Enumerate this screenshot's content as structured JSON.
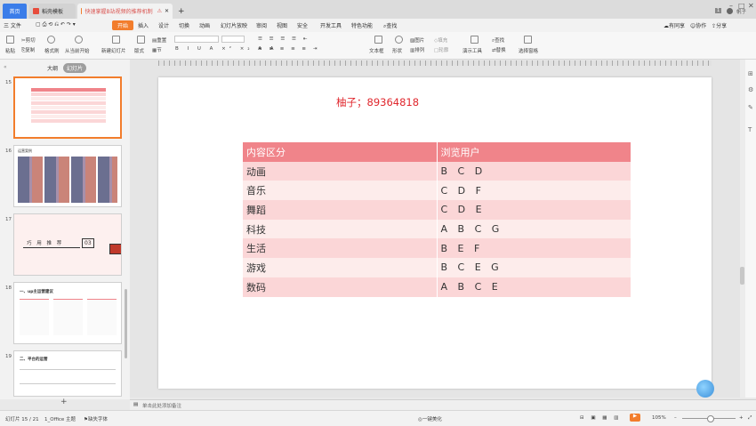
{
  "tabs": {
    "home": "首页",
    "template": "稻壳模板",
    "doc": "快速掌握B站视频的推荐机制",
    "add": "+"
  },
  "window": {
    "badge": "1",
    "user": "帆子"
  },
  "menubar": {
    "file": "三 文件",
    "items": [
      "开始",
      "插入",
      "设计",
      "切换",
      "动画",
      "幻灯片放映",
      "审阅",
      "视图",
      "安全",
      "开发工具",
      "特色功能"
    ],
    "active": "开始",
    "search": "查找",
    "right": [
      "有同享",
      "协作",
      "分享"
    ]
  },
  "ribbon": {
    "paste": "粘贴",
    "cut": "剪切",
    "copy": "复制",
    "format_painter": "格式刷",
    "from_start": "从当前开始",
    "new_slide": "新建幻灯片",
    "layout": "版式",
    "section": "节",
    "reset": "重置",
    "textbox": "文本框",
    "shape": "形状",
    "arrange": "排列",
    "picture": "图片",
    "fill": "填充",
    "outline": "轮廓",
    "presentation_tool": "演示工具",
    "find": "查找",
    "replace": "替换",
    "select_pane": "选择窗格"
  },
  "leftpane": {
    "tab_outline": "大纲",
    "tab_slides": "幻灯片",
    "slides": [
      {
        "num": "15",
        "selected": true
      },
      {
        "num": "16",
        "title": "运营案例"
      },
      {
        "num": "17",
        "title": "巧 用 推 荐",
        "badge": "03"
      },
      {
        "num": "18",
        "title": "一、up主运营建议"
      },
      {
        "num": "19",
        "title": "二、平台的运营"
      }
    ],
    "add_slide": "+"
  },
  "slide": {
    "title": "柚子；89364818",
    "table": {
      "headers": [
        "内容区分",
        "浏览用户"
      ],
      "rows": [
        [
          "动画",
          "B C D"
        ],
        [
          "音乐",
          "C D F"
        ],
        [
          "舞蹈",
          "C D E"
        ],
        [
          "科技",
          "A B C G"
        ],
        [
          "生活",
          "B E F"
        ],
        [
          "游戏",
          "B C E G"
        ],
        [
          "数码",
          "A B C E"
        ]
      ]
    }
  },
  "notes": {
    "placeholder": "单击此处添加备注"
  },
  "statusbar": {
    "slide_count": "幻灯片 15 / 21",
    "theme": "1_Office 主题",
    "font_missing": "缺失字体",
    "beautify": "一键美化",
    "zoom": "105%"
  },
  "colors": {
    "accent": "#f27d2c",
    "table_header": "#f0848a",
    "row_odd": "#fbd6d7",
    "row_even": "#fdeceb",
    "title_red": "#e0272d"
  }
}
